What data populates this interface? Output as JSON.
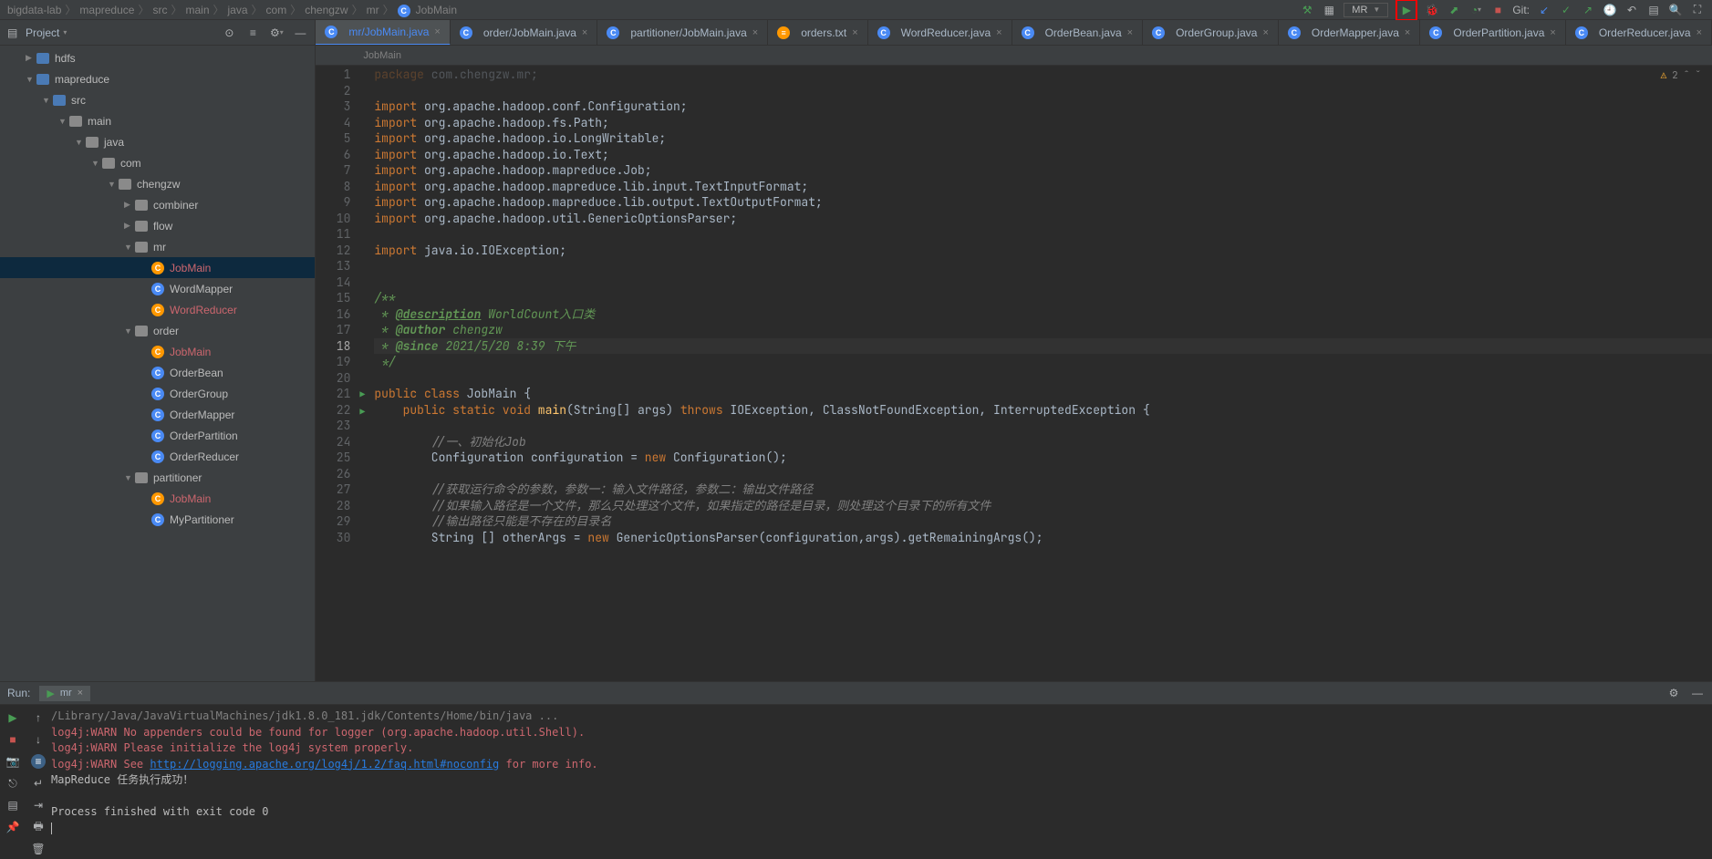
{
  "breadcrumb": {
    "items": [
      "bigdata-lab",
      "mapreduce",
      "src",
      "main",
      "java",
      "com",
      "chengzw",
      "mr",
      "JobMain"
    ],
    "sep": "〉"
  },
  "toolbar": {
    "run_config": "MR",
    "git_label": "Git:"
  },
  "project": {
    "title": "Project",
    "dropdown_caret": "▾",
    "tree": [
      {
        "depth": 1,
        "exp": "▶",
        "icon": "module",
        "label": "hdfs"
      },
      {
        "depth": 1,
        "exp": "▼",
        "icon": "module",
        "label": "mapreduce"
      },
      {
        "depth": 2,
        "exp": "▼",
        "icon": "src",
        "label": "src"
      },
      {
        "depth": 3,
        "exp": "▼",
        "icon": "folder",
        "label": "main"
      },
      {
        "depth": 4,
        "exp": "▼",
        "icon": "folder",
        "label": "java"
      },
      {
        "depth": 5,
        "exp": "▼",
        "icon": "folder",
        "label": "com"
      },
      {
        "depth": 6,
        "exp": "▼",
        "icon": "folder",
        "label": "chengzw"
      },
      {
        "depth": 7,
        "exp": "▶",
        "icon": "folder",
        "label": "combiner"
      },
      {
        "depth": 7,
        "exp": "▶",
        "icon": "folder",
        "label": "flow"
      },
      {
        "depth": 7,
        "exp": "▼",
        "icon": "folder",
        "label": "mr"
      },
      {
        "depth": 8,
        "icon": "c",
        "label": "JobMain",
        "selected": true,
        "warn": true
      },
      {
        "depth": 8,
        "icon": "c",
        "label": "WordMapper"
      },
      {
        "depth": 8,
        "icon": "c",
        "label": "WordReducer",
        "warn": true
      },
      {
        "depth": 7,
        "exp": "▼",
        "icon": "folder",
        "label": "order"
      },
      {
        "depth": 8,
        "icon": "c",
        "label": "JobMain",
        "warn": true
      },
      {
        "depth": 8,
        "icon": "c",
        "label": "OrderBean"
      },
      {
        "depth": 8,
        "icon": "c",
        "label": "OrderGroup"
      },
      {
        "depth": 8,
        "icon": "c",
        "label": "OrderMapper"
      },
      {
        "depth": 8,
        "icon": "c",
        "label": "OrderPartition"
      },
      {
        "depth": 8,
        "icon": "c",
        "label": "OrderReducer"
      },
      {
        "depth": 7,
        "exp": "▼",
        "icon": "folder",
        "label": "partitioner"
      },
      {
        "depth": 8,
        "icon": "c",
        "label": "JobMain",
        "warn": true
      },
      {
        "depth": 8,
        "icon": "c",
        "label": "MyPartitioner"
      }
    ]
  },
  "tabs": [
    {
      "label": "mr/JobMain.java",
      "icon": "c",
      "active": true,
      "modified": true
    },
    {
      "label": "order/JobMain.java",
      "icon": "c"
    },
    {
      "label": "partitioner/JobMain.java",
      "icon": "c"
    },
    {
      "label": "orders.txt",
      "icon": "txt"
    },
    {
      "label": "WordReducer.java",
      "icon": "c"
    },
    {
      "label": "OrderBean.java",
      "icon": "c"
    },
    {
      "label": "OrderGroup.java",
      "icon": "c"
    },
    {
      "label": "OrderMapper.java",
      "icon": "c"
    },
    {
      "label": "OrderPartition.java",
      "icon": "c"
    },
    {
      "label": "OrderReducer.java",
      "icon": "c"
    }
  ],
  "editor_breadcrumb": "JobMain",
  "problems": {
    "warn_icon": "⚠",
    "warn_count": "2",
    "up": "ˆ",
    "down": "ˇ"
  },
  "code": {
    "currentLine": 18,
    "lines": [
      {
        "n": 1,
        "html": "<span class='kw'>package</span> <span class='pkg'>com.chengzw.mr;</span>",
        "dim": true
      },
      {
        "n": 2,
        "html": ""
      },
      {
        "n": 3,
        "html": "<span class='kw'>import</span> <span class='pkg'>org.apache.hadoop.conf.Configuration;</span>"
      },
      {
        "n": 4,
        "html": "<span class='kw'>import</span> <span class='pkg'>org.apache.hadoop.fs.Path;</span>"
      },
      {
        "n": 5,
        "html": "<span class='kw'>import</span> <span class='pkg'>org.apache.hadoop.io.LongWritable;</span>"
      },
      {
        "n": 6,
        "html": "<span class='kw'>import</span> <span class='pkg'>org.apache.hadoop.io.Text;</span>"
      },
      {
        "n": 7,
        "html": "<span class='kw'>import</span> <span class='pkg'>org.apache.hadoop.mapreduce.Job;</span>"
      },
      {
        "n": 8,
        "html": "<span class='kw'>import</span> <span class='pkg'>org.apache.hadoop.mapreduce.lib.input.TextInputFormat;</span>"
      },
      {
        "n": 9,
        "html": "<span class='kw'>import</span> <span class='pkg'>org.apache.hadoop.mapreduce.lib.output.TextOutputFormat;</span>"
      },
      {
        "n": 10,
        "html": "<span class='kw'>import</span> <span class='pkg'>org.apache.hadoop.util.GenericOptionsParser;</span>"
      },
      {
        "n": 11,
        "html": ""
      },
      {
        "n": 12,
        "html": "<span class='kw'>import</span> <span class='pkg'>java.io.IOException;</span>"
      },
      {
        "n": 13,
        "html": ""
      },
      {
        "n": 14,
        "html": ""
      },
      {
        "n": 15,
        "html": "<span class='doc'>/**</span>"
      },
      {
        "n": 16,
        "html": "<span class='doc'> * </span><span class='docann'>@description</span><span class='doc'> WorldCount入口类</span>"
      },
      {
        "n": 17,
        "html": "<span class='doc'> * </span><span class='doc'><b>@author</b> chengzw</span>"
      },
      {
        "n": 18,
        "html": "<span class='doc'> * </span><span class='doc'><b>@since</b> 2021/5/20 8:39 下午</span>",
        "curr": true
      },
      {
        "n": 19,
        "html": "<span class='doc'> */</span>"
      },
      {
        "n": 20,
        "html": ""
      },
      {
        "n": 21,
        "html": "<span class='kw'>public class</span> <span class='cls'>JobMain</span> {",
        "run": true
      },
      {
        "n": 22,
        "html": "    <span class='kw'>public static void</span> <span class='fn'>main</span>(String[] args) <span class='kw'>throws</span> IOException, ClassNotFoundException, InterruptedException {",
        "run": true
      },
      {
        "n": 23,
        "html": ""
      },
      {
        "n": 24,
        "html": "        <span class='cmt'>//一、初始化Job</span>"
      },
      {
        "n": 25,
        "html": "        Configuration <span class='cls'>configuration</span> = <span class='kw'>new</span> Configuration();"
      },
      {
        "n": 26,
        "html": ""
      },
      {
        "n": 27,
        "html": "        <span class='cmt'>//获取运行命令的参数，参数一：输入文件路径，参数二：输出文件路径</span>"
      },
      {
        "n": 28,
        "html": "        <span class='cmt'>//如果输入路径是一个文件，那么只处理这个文件，如果指定的路径是目录，则处理这个目录下的所有文件</span>"
      },
      {
        "n": 29,
        "html": "        <span class='cmt'>//输出路径只能是不存在的目录名</span>"
      },
      {
        "n": 30,
        "html": "        String [] otherArgs = <span class='kw'>new</span> GenericOptionsParser(configuration,args).getRemainingArgs();"
      }
    ]
  },
  "run": {
    "label": "Run:",
    "tab_label": "mr",
    "console": [
      {
        "cls": "info",
        "text": "/Library/Java/JavaVirtualMachines/jdk1.8.0_181.jdk/Contents/Home/bin/java ..."
      },
      {
        "cls": "warn",
        "text": "log4j:WARN No appenders could be found for logger (org.apache.hadoop.util.Shell)."
      },
      {
        "cls": "warn",
        "text": "log4j:WARN Please initialize the log4j system properly."
      },
      {
        "cls": "warn",
        "prefix": "log4j:WARN See ",
        "link": "http://logging.apache.org/log4j/1.2/faq.html#noconfig",
        "suffix": " for more info."
      },
      {
        "cls": "",
        "text": "MapReduce 任务执行成功！"
      },
      {
        "cls": "",
        "text": ""
      },
      {
        "cls": "",
        "text": "Process finished with exit code 0"
      }
    ]
  }
}
